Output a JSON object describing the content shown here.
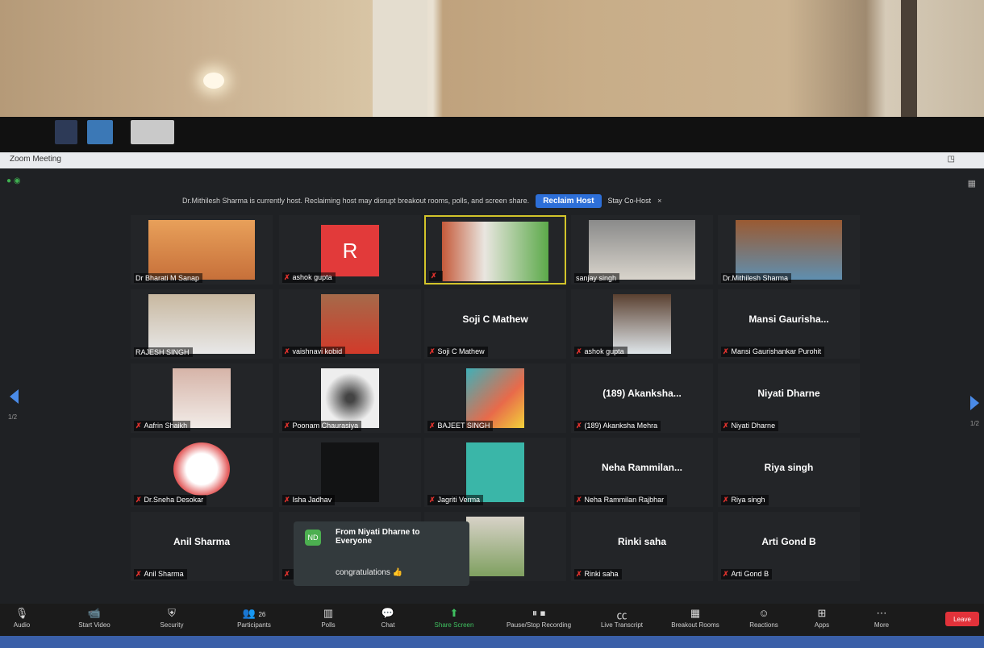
{
  "window": {
    "title": "Zoom Meeting"
  },
  "host_banner": {
    "message": "Dr.Mithilesh Sharma is currently host. Reclaiming host may disrupt breakout rooms, polls, and screen share.",
    "reclaim_label": "Reclaim Host",
    "stay_label": "Stay Co-Host",
    "close_glyph": "×"
  },
  "pagination": {
    "left": "1/2",
    "right": "1/2"
  },
  "participants": [
    {
      "label": "Dr Bharati M Sanap",
      "muted": false,
      "video": true
    },
    {
      "label": "ashok gupta",
      "muted": true,
      "avatar_letter": "R"
    },
    {
      "label": "",
      "muted": true,
      "video": true,
      "active_speaker": true
    },
    {
      "label": "sanjay singh",
      "muted": false,
      "video": true
    },
    {
      "label": "Dr.Mithilesh Sharma",
      "muted": false,
      "video": true
    },
    {
      "label": "RAJESH SINGH",
      "muted": false,
      "video": true
    },
    {
      "label": "vaishnavi kobid",
      "muted": true,
      "video": true
    },
    {
      "label": "Soji C Mathew",
      "muted": true,
      "display_name": "Soji C Mathew"
    },
    {
      "label": "ashok gupta",
      "muted": true,
      "video": true
    },
    {
      "label": "Mansi Gaurishankar Purohit",
      "muted": true,
      "display_name": "Mansi Gaurisha..."
    },
    {
      "label": "Aafrin Shaikh",
      "muted": true,
      "video": true
    },
    {
      "label": "Poonam Chaurasiya",
      "muted": true,
      "video": true
    },
    {
      "label": "BAJEET SINGH",
      "muted": true,
      "video": true
    },
    {
      "label": "(189) Akanksha Mehra",
      "muted": true,
      "display_name": "(189) Akanksha..."
    },
    {
      "label": "Niyati Dharne",
      "muted": true,
      "display_name": "Niyati Dharne"
    },
    {
      "label": "Dr.Sneha Desokar",
      "muted": true,
      "video": true
    },
    {
      "label": "Isha Jadhav",
      "muted": true,
      "video": true
    },
    {
      "label": "Jagriti Verma",
      "muted": true,
      "video": true
    },
    {
      "label": "Neha Rammilan Rajbhar",
      "muted": true,
      "display_name": "Neha Rammilan..."
    },
    {
      "label": "Riya singh",
      "muted": true,
      "display_name": "Riya singh"
    },
    {
      "label": "Anil Sharma",
      "muted": true,
      "display_name": "Anil Sharma"
    },
    {
      "label": "",
      "muted": true
    },
    {
      "label": "",
      "muted": true,
      "video": true
    },
    {
      "label": "Rinki saha",
      "muted": true,
      "display_name": "Rinki saha"
    },
    {
      "label": "Arti Gond B",
      "muted": true,
      "display_name": "Arti Gond B"
    }
  ],
  "chat_popup": {
    "icon_text": "ND",
    "from": "From Niyati Dharne to Everyone",
    "message": "congratulations 👍"
  },
  "toolbar": {
    "buttons": [
      {
        "label": "Audio",
        "icon": "microphone-icon"
      },
      {
        "label": "Start Video",
        "icon": "video-camera-icon"
      },
      {
        "label": "Security",
        "icon": "shield-icon"
      },
      {
        "label": "Participants",
        "icon": "people-icon",
        "count": "26"
      },
      {
        "label": "Polls",
        "icon": "polls-icon"
      },
      {
        "label": "Chat",
        "icon": "chat-icon"
      },
      {
        "label": "Share Screen",
        "icon": "share-screen-icon"
      },
      {
        "label": "Pause/Stop Recording",
        "icon": "record-icon"
      },
      {
        "label": "Live Transcript",
        "icon": "cc-icon"
      },
      {
        "label": "Breakout Rooms",
        "icon": "breakout-icon"
      },
      {
        "label": "Reactions",
        "icon": "smile-icon"
      },
      {
        "label": "Apps",
        "icon": "apps-icon"
      },
      {
        "label": "More",
        "icon": "ellipsis-icon"
      }
    ],
    "leave_label": "Leave"
  }
}
